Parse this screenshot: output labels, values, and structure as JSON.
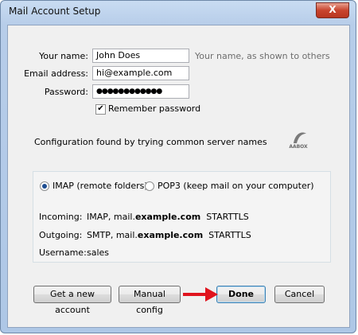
{
  "window": {
    "title": "Mail Account Setup",
    "close_glyph": "X"
  },
  "form": {
    "name_label": "Your name:",
    "name_value": "John Does",
    "name_hint": "Your name, as shown to others",
    "email_label": "Email address:",
    "email_value": "hi@example.com",
    "password_label": "Password:",
    "password_value": "●●●●●●●●●●●●",
    "remember_label": "Remember password",
    "remember_checked": true
  },
  "status_text": "Configuration found by trying common server names",
  "logo_text": "AABOX",
  "protocol": {
    "imap_label": "IMAP (remote folders)",
    "pop3_label": "POP3 (keep mail on your computer)",
    "selected": "imap"
  },
  "servers": {
    "incoming_label": "Incoming:",
    "incoming_proto": "IMAP, mail.",
    "incoming_host": "example.com",
    "incoming_security": "STARTTLS",
    "outgoing_label": "Outgoing:",
    "outgoing_proto": "SMTP, mail.",
    "outgoing_host": "example.com",
    "outgoing_security": "STARTTLS",
    "username_label": "Username:",
    "username_value": "sales"
  },
  "buttons": {
    "get_account": "Get a new account",
    "manual_config": "Manual config",
    "done": "Done",
    "cancel": "Cancel"
  },
  "colors": {
    "arrow": "#e0141e",
    "radio_dot": "#1e4d91"
  }
}
